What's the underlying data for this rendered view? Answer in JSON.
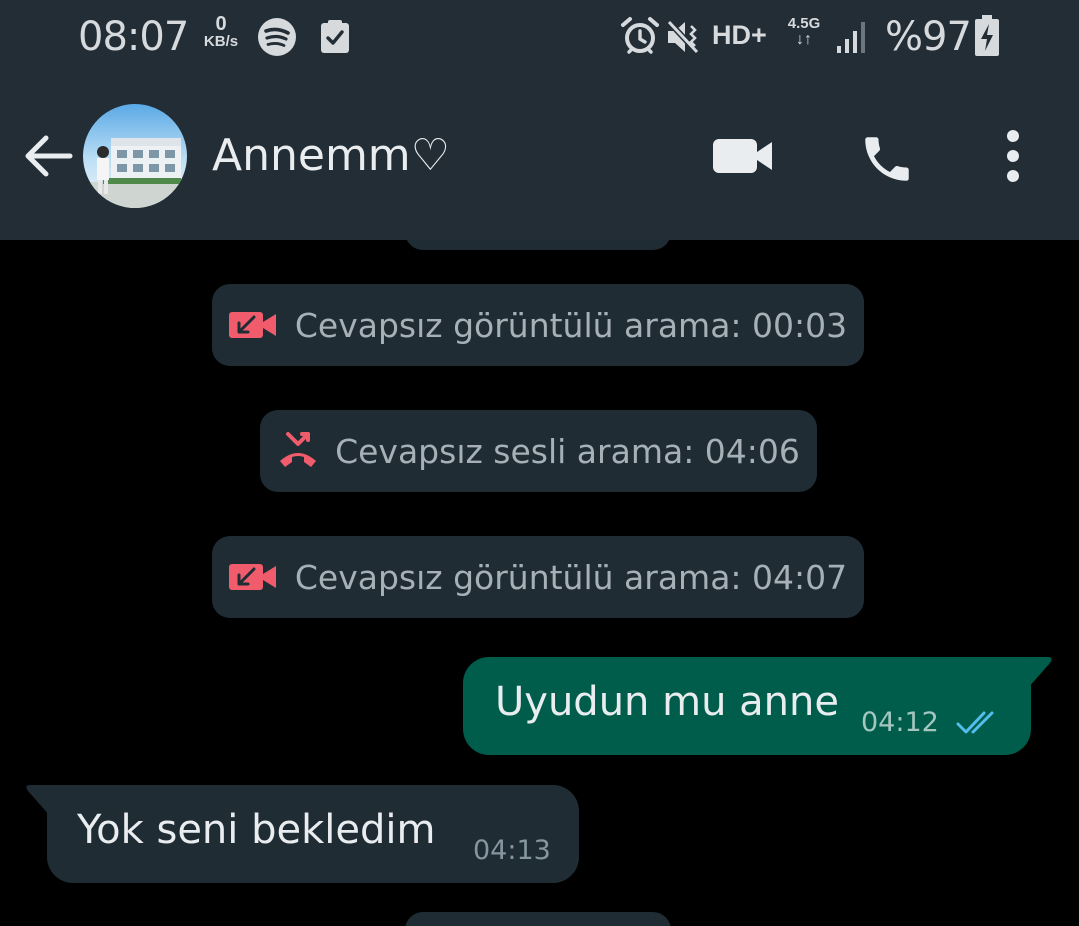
{
  "status_bar": {
    "time": "08:07",
    "net_speed_value": "0",
    "net_speed_unit": "KB/s",
    "network_label": "HD+",
    "network_gen": "4.5G",
    "network_arrows": "↓↑",
    "battery_text": "%97",
    "icons": [
      "spotify-icon",
      "check-notification-icon",
      "alarm-icon",
      "mute-icon",
      "signal-icon",
      "battery-charging-icon"
    ]
  },
  "header": {
    "contact_name": "Annemm♡",
    "icons": [
      "back-arrow-icon",
      "video-call-icon",
      "voice-call-icon",
      "more-options-icon"
    ]
  },
  "messages": {
    "calls": [
      {
        "icon": "missed-video-call-icon",
        "text": "Cevapsız görüntülü arama: 00:03"
      },
      {
        "icon": "missed-voice-call-icon",
        "text": "Cevapsız sesli arama: 04:06"
      },
      {
        "icon": "missed-video-call-icon",
        "text": "Cevapsız görüntülü arama: 04:07"
      }
    ],
    "outgoing": {
      "text": "Uyudun  mu anne",
      "time": "04:12",
      "status_icon": "double-check-read-icon"
    },
    "incoming": {
      "text": "Yok seni bekledim",
      "time": "04:13"
    }
  },
  "colors": {
    "header_bg": "#232d36",
    "chat_bg": "#000000",
    "outgoing_bubble": "#005c4b",
    "incoming_bubble": "#1f2c34",
    "missed_call_red": "#f15c6d",
    "read_tick_blue": "#53bdeb"
  }
}
